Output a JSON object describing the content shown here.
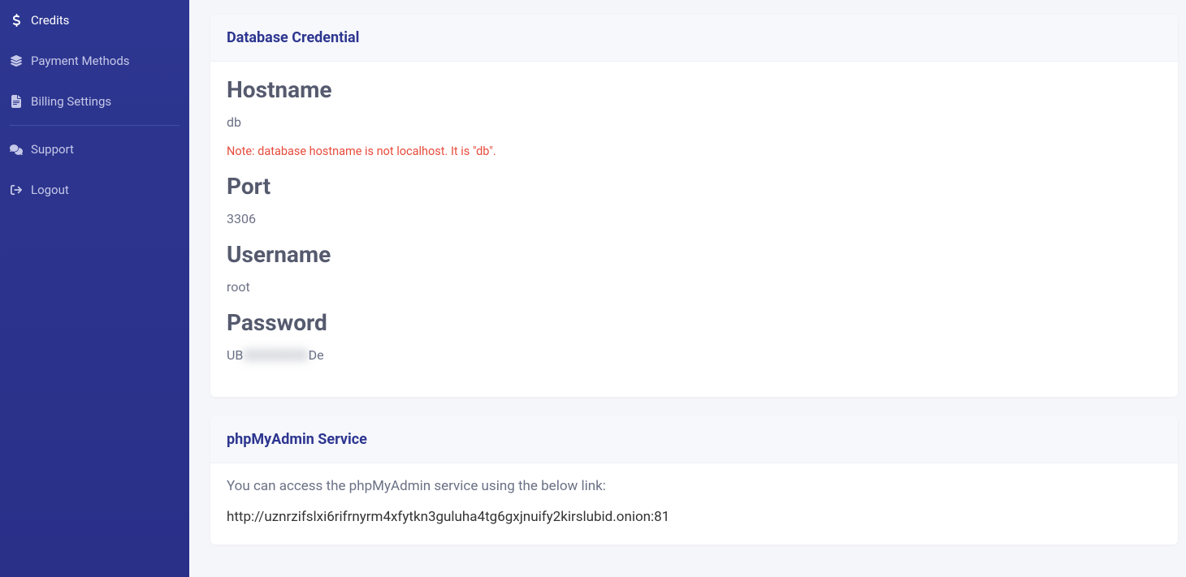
{
  "sidebar": {
    "items": [
      {
        "label": "Credits",
        "icon": "dollar-icon"
      },
      {
        "label": "Payment Methods",
        "icon": "layers-icon"
      },
      {
        "label": "Billing Settings",
        "icon": "file-icon"
      },
      {
        "label": "Support",
        "icon": "chat-icon"
      },
      {
        "label": "Logout",
        "icon": "logout-icon"
      }
    ]
  },
  "cards": {
    "dbcred": {
      "title": "Database Credential",
      "hostname": {
        "label": "Hostname",
        "value": "db",
        "note": "Note: database hostname is not localhost. It is \"db\"."
      },
      "port": {
        "label": "Port",
        "value": "3306"
      },
      "username": {
        "label": "Username",
        "value": "root"
      },
      "password": {
        "label": "Password",
        "value_prefix": "UB",
        "value_hidden": "XXXXXXXX",
        "value_suffix": "De"
      }
    },
    "pma": {
      "title": "phpMyAdmin Service",
      "text": "You can access the phpMyAdmin service using the below link:",
      "link": "http://uznrzifslxi6rifrnyrm4xfytkn3guluha4tg6gxjnuify2kirslubid.onion:81"
    }
  }
}
